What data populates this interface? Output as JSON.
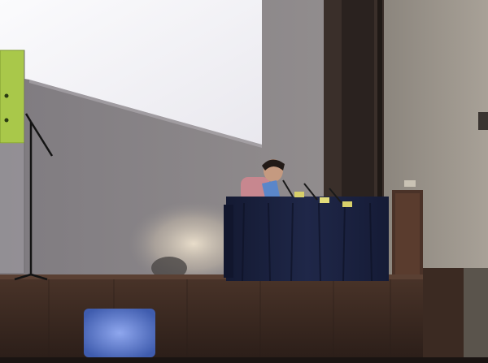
{
  "scene": {
    "colors": {
      "wall_left": "#8f8b8e",
      "wall_right": "#9a948c",
      "screen": "#f4f3f6",
      "stage_wood": "#3b2a22",
      "table_cloth": "#1a2140",
      "banner": "#a9c84a",
      "projected_spot": "#5e7fd6"
    },
    "objects": [
      "projection-screen",
      "speaker",
      "laptop",
      "table-microphones",
      "name-placards",
      "microphone-stand",
      "event-banner",
      "wooden-stage",
      "side-door",
      "pillar"
    ]
  }
}
